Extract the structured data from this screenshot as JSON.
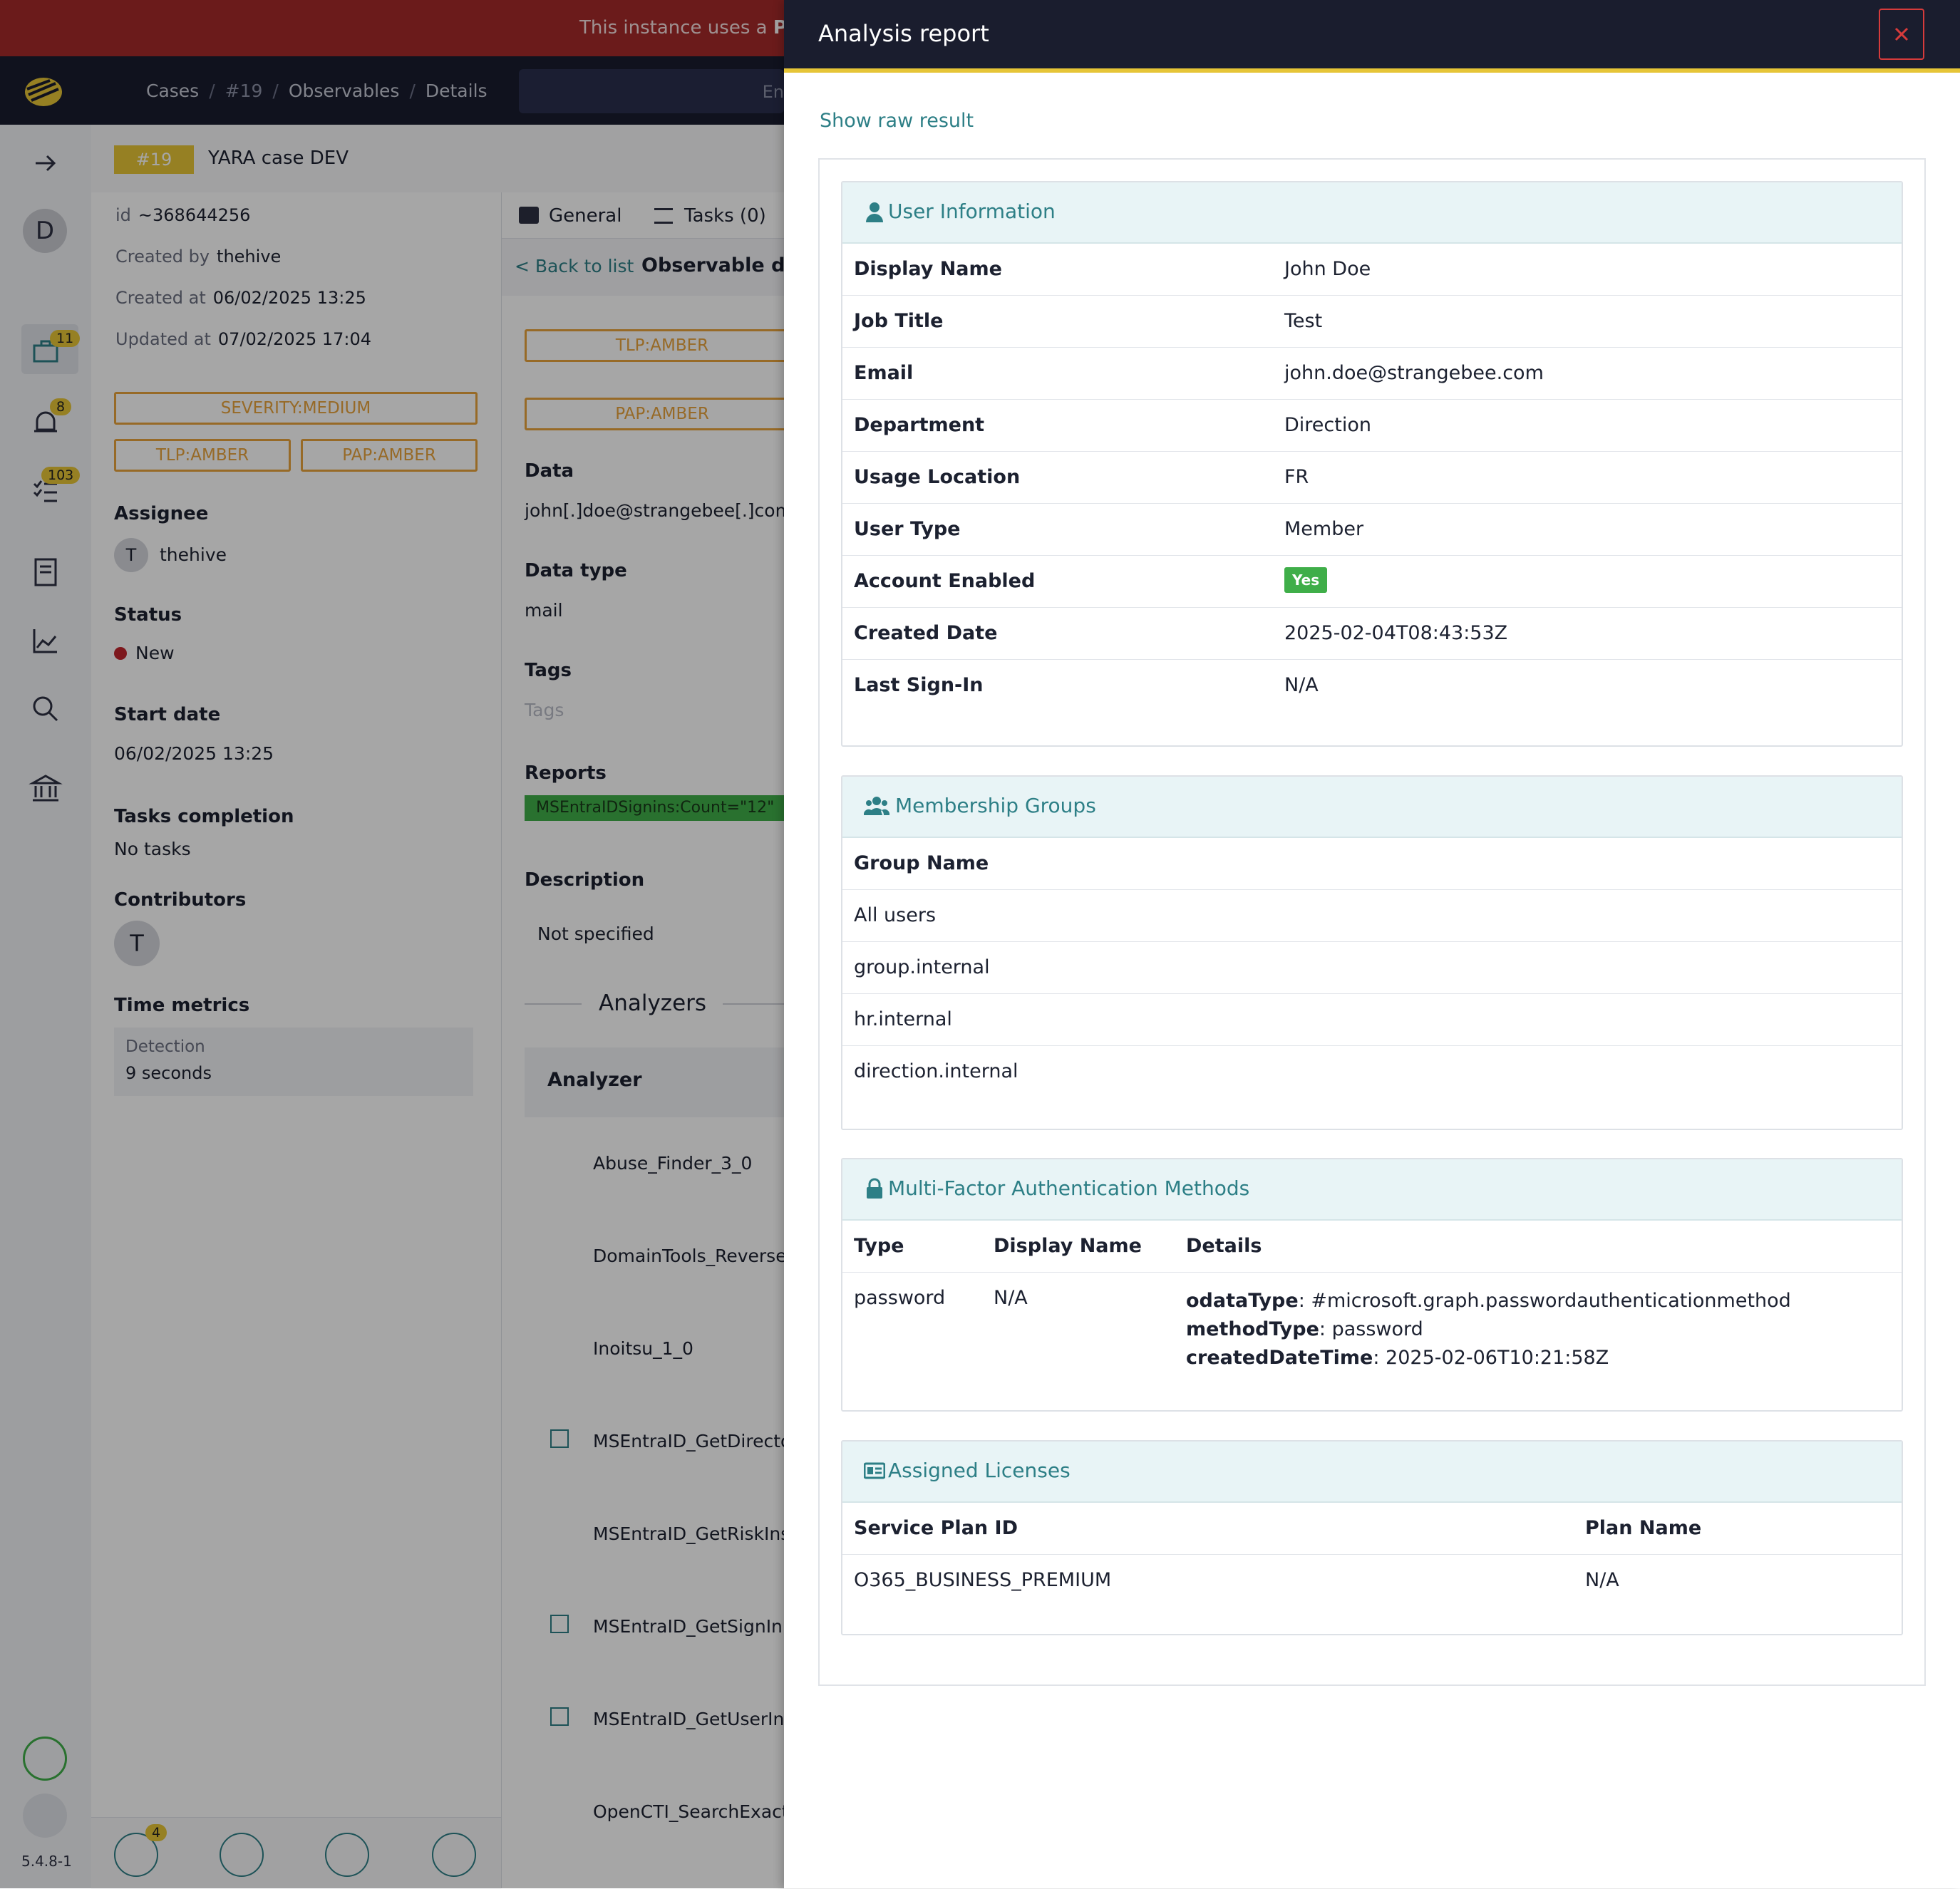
{
  "banner": {
    "text": "This instance uses a ",
    "bold": "Pla"
  },
  "breadcrumb": {
    "cases": "Cases",
    "num": "#19",
    "observables": "Observables",
    "details": "Details"
  },
  "search": {
    "placeholder": "En"
  },
  "rail": {
    "badge_cases": "11",
    "badge_alerts": "8",
    "badge_tasks": "103",
    "version": "5.4.8-1",
    "avatar": "D"
  },
  "case": {
    "number": "#19",
    "title": "YARA case DEV",
    "id_label": "id",
    "id": "~368644256",
    "created_by_label": "Created by",
    "created_by": "thehive",
    "created_at_label": "Created at",
    "created_at": "06/02/2025 13:25",
    "updated_at_label": "Updated at",
    "updated_at": "07/02/2025 17:04",
    "severity": "SEVERITY:MEDIUM",
    "tlp": "TLP:AMBER",
    "pap": "PAP:AMBER",
    "assignee_label": "Assignee",
    "assignee_initial": "T",
    "assignee": "thehive",
    "status_label": "Status",
    "status": "New",
    "start_date_label": "Start date",
    "start_date": "06/02/2025 13:25",
    "tasks_label": "Tasks completion",
    "tasks": "No tasks",
    "contributors_label": "Contributors",
    "contributor_initial": "T",
    "metrics_label": "Time metrics",
    "detection_label": "Detection",
    "detection": "9 seconds",
    "bottom_badge": "4"
  },
  "middle": {
    "tab_general": "General",
    "tab_tasks": "Tasks (0)",
    "back": "< Back to list",
    "heading": "Observable det",
    "tlp": "TLP:AMBER",
    "pap": "PAP:AMBER",
    "data_label": "Data",
    "data": "john[.]doe@strangebee[.]com",
    "type_label": "Data type",
    "type": "mail",
    "tags_label": "Tags",
    "tags_placeholder": "Tags",
    "reports_label": "Reports",
    "report_tag": "MSEntraIDSignins:Count=\"12\"",
    "desc_label": "Description",
    "desc": "Not specified",
    "analyzers_title": "Analyzers",
    "analyzer_col": "Analyzer",
    "analyzers": [
      "Abuse_Finder_3_0",
      "DomainTools_Reverse",
      "Inoitsu_1_0",
      "MSEntraID_GetDirecto",
      "MSEntraID_GetRiskIns",
      "MSEntraID_GetSignIn",
      "MSEntraID_GetUserIn",
      "OpenCTI_SearchExact"
    ]
  },
  "modal": {
    "title": "Analysis report",
    "raw_link": "Show raw result",
    "user_info": {
      "title": "User Information",
      "rows": [
        {
          "k": "Display Name",
          "v": "John Doe"
        },
        {
          "k": "Job Title",
          "v": "Test"
        },
        {
          "k": "Email",
          "v": "john.doe@strangebee.com"
        },
        {
          "k": "Department",
          "v": "Direction"
        },
        {
          "k": "Usage Location",
          "v": "FR"
        },
        {
          "k": "User Type",
          "v": "Member"
        },
        {
          "k": "Account Enabled",
          "v": "Yes"
        },
        {
          "k": "Created Date",
          "v": "2025-02-04T08:43:53Z"
        },
        {
          "k": "Last Sign-In",
          "v": "N/A"
        }
      ]
    },
    "groups": {
      "title": "Membership Groups",
      "header": "Group Name",
      "items": [
        "All users",
        "group.internal",
        "hr.internal",
        "direction.internal"
      ]
    },
    "mfa": {
      "title": "Multi-Factor Authentication Methods",
      "headers": [
        "Type",
        "Display Name",
        "Details"
      ],
      "type": "password",
      "display": "N/A",
      "details": [
        {
          "k": "odataType",
          "v": ": #microsoft.graph.passwordauthenticationmethod"
        },
        {
          "k": "methodType",
          "v": ": password"
        },
        {
          "k": "createdDateTime",
          "v": ": 2025-02-06T10:21:58Z"
        }
      ]
    },
    "licenses": {
      "title": "Assigned Licenses",
      "headers": [
        "Service Plan ID",
        "Plan Name"
      ],
      "plan_id": "O365_BUSINESS_PREMIUM",
      "plan_name": "N/A"
    }
  },
  "colors": {
    "accent": "#2d7f86",
    "warning": "#e8a33c",
    "brand_yellow": "#e6c537",
    "banner": "#a52a2a",
    "navy": "#1a1d2e"
  }
}
